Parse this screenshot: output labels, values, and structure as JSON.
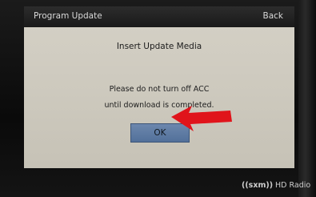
{
  "titlebar": {
    "title": "Program Update",
    "back_label": "Back"
  },
  "dialog": {
    "heading": "Insert Update Media",
    "message_line1": "Please do not turn off ACC",
    "message_line2": "until download is completed.",
    "ok_label": "OK"
  },
  "annotation": {
    "arrow_color": "#e0141b",
    "icon": "arrow-left-icon"
  },
  "footer": {
    "sxm_logo": "((sxm))",
    "hd_radio_logo": "HD Radio"
  },
  "colors": {
    "screen_bg": "#c9c5ba",
    "titlebar_bg": "#222222",
    "ok_button_bg": "#5f7ba3"
  }
}
